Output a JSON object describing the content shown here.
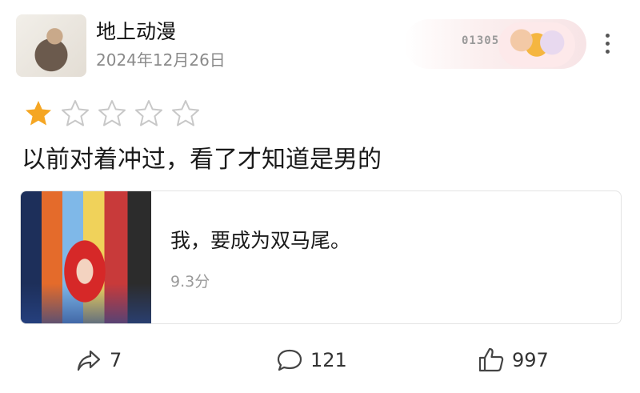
{
  "post": {
    "username": "地上动漫",
    "date": "2024年12月26日",
    "badge_number": "013051",
    "rating": 1,
    "rating_max": 5,
    "text": "以前对着冲过，看了才知道是男的"
  },
  "card": {
    "title": "我，要成为双马尾。",
    "score": "9.3分"
  },
  "actions": {
    "share_count": "7",
    "comment_count": "121",
    "like_count": "997"
  },
  "colors": {
    "star_filled": "#f5a623",
    "star_empty": "#c8c8c8"
  }
}
